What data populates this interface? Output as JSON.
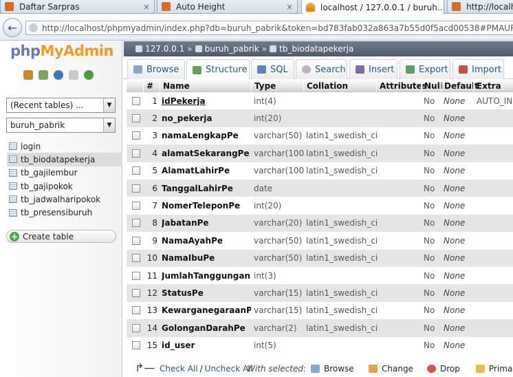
{
  "browser": {
    "tabs": [
      {
        "title": "Daftar Sarpras"
      },
      {
        "title": "Auto Height"
      },
      {
        "title": "localhost / 127.0.0.1 / buruh..."
      },
      {
        "title": "http://localh..."
      }
    ],
    "close_glyph": "×",
    "url": "http://localhost/phpmyadmin/index.php?db=buruh_pabrik&token=bd783fab032a863a7b55d0f5acd00538#PMAURL:db=buruh_pabrik&table=tb_biodatapekerja"
  },
  "sidebar": {
    "logo_php": "php",
    "logo_myadmin": "MyAdmin",
    "recent_select": "(Recent tables) ...",
    "db_select": "buruh_pabrik",
    "tables": [
      "login",
      "tb_biodatapekerja",
      "tb_gajilembur",
      "tb_gajipokok",
      "tb_jadwalharipokok",
      "tb_presensiburuh"
    ],
    "selected_table": "tb_biodatapekerja",
    "create_table": "Create table"
  },
  "breadcrumb": {
    "server": "127.0.0.1",
    "database": "buruh_pabrik",
    "table": "tb_biodatapekerja",
    "separator": "»"
  },
  "tabs": [
    "Browse",
    "Structure",
    "SQL",
    "Search",
    "Insert",
    "Export",
    "Import"
  ],
  "active_tab": "Structure",
  "structure": {
    "headers": [
      "#",
      "Name",
      "Type",
      "Collation",
      "Attributes",
      "Null",
      "Default",
      "Extra"
    ],
    "rows": [
      {
        "n": "1",
        "name": "idPekerja",
        "type": "int(4)",
        "collation": "",
        "null": "No",
        "default": "None",
        "extra": "AUTO_INCREMENT",
        "pk": true
      },
      {
        "n": "2",
        "name": "no_pekerja",
        "type": "int(20)",
        "collation": "",
        "null": "No",
        "default": "None",
        "extra": ""
      },
      {
        "n": "3",
        "name": "namaLengkapPe",
        "type": "varchar(50)",
        "collation": "latin1_swedish_ci",
        "null": "No",
        "default": "None",
        "extra": ""
      },
      {
        "n": "4",
        "name": "alamatSekarangPe",
        "type": "varchar(100)",
        "collation": "latin1_swedish_ci",
        "null": "No",
        "default": "None",
        "extra": ""
      },
      {
        "n": "5",
        "name": "AlamatLahirPe",
        "type": "varchar(100)",
        "collation": "latin1_swedish_ci",
        "null": "No",
        "default": "None",
        "extra": ""
      },
      {
        "n": "6",
        "name": "TanggalLahirPe",
        "type": "date",
        "collation": "",
        "null": "No",
        "default": "None",
        "extra": ""
      },
      {
        "n": "7",
        "name": "NomerTeleponPe",
        "type": "int(20)",
        "collation": "",
        "null": "No",
        "default": "None",
        "extra": ""
      },
      {
        "n": "8",
        "name": "JabatanPe",
        "type": "varchar(20)",
        "collation": "latin1_swedish_ci",
        "null": "No",
        "default": "None",
        "extra": ""
      },
      {
        "n": "9",
        "name": "NamaAyahPe",
        "type": "varchar(50)",
        "collation": "latin1_swedish_ci",
        "null": "No",
        "default": "None",
        "extra": ""
      },
      {
        "n": "10",
        "name": "NamaIbuPe",
        "type": "varchar(50)",
        "collation": "latin1_swedish_ci",
        "null": "No",
        "default": "None",
        "extra": ""
      },
      {
        "n": "11",
        "name": "JumlahTanggunganPe",
        "type": "int(3)",
        "collation": "",
        "null": "No",
        "default": "None",
        "extra": ""
      },
      {
        "n": "12",
        "name": "StatusPe",
        "type": "varchar(15)",
        "collation": "latin1_swedish_ci",
        "null": "No",
        "default": "None",
        "extra": ""
      },
      {
        "n": "13",
        "name": "KewarganegaraanPe",
        "type": "varchar(15)",
        "collation": "latin1_swedish_ci",
        "null": "No",
        "default": "None",
        "extra": ""
      },
      {
        "n": "14",
        "name": "GolonganDarahPe",
        "type": "varchar(2)",
        "collation": "latin1_swedish_ci",
        "null": "No",
        "default": "None",
        "extra": ""
      },
      {
        "n": "15",
        "name": "id_user",
        "type": "int(5)",
        "collation": "",
        "null": "No",
        "default": "None",
        "extra": ""
      }
    ]
  },
  "footer": {
    "check_all": "Check All",
    "slash": "/",
    "uncheck_all": "Uncheck All",
    "with_selected": "With selected:",
    "actions": [
      "Browse",
      "Change",
      "Drop",
      "Primary"
    ]
  },
  "colors": {
    "link": "#235a81",
    "logo_php": "#6c78af",
    "logo_myadmin": "#f29a24",
    "row_alt": "#e5e5e5",
    "breadcrumb_bg": "#5f6b7a"
  }
}
